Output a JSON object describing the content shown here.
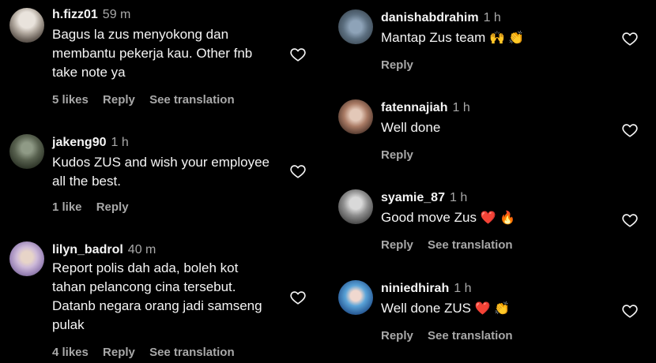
{
  "left_comments": [
    {
      "username": "h.fizz01",
      "time": "59 m",
      "lines": [
        "Bagus la zus menyokong dan",
        "membantu pekerja kau. Other fnb",
        "take note ya"
      ],
      "likes": "5 likes",
      "reply": "Reply",
      "translate": "See translation"
    },
    {
      "username": "jakeng90",
      "time": "1 h",
      "lines": [
        "Kudos ZUS and wish your employee",
        "all the best."
      ],
      "likes": "1 like",
      "reply": "Reply",
      "translate": ""
    },
    {
      "username": "lilyn_badrol",
      "time": "40 m",
      "lines": [
        "Report polis dah ada, boleh kot",
        "tahan pelancong cina tersebut.",
        "Datanb negara orang jadi samseng",
        "pulak"
      ],
      "likes": "4 likes",
      "reply": "Reply",
      "translate": "See translation"
    }
  ],
  "right_comments": [
    {
      "username": "danishabdrahim",
      "time": "1 h",
      "text": "Mantap Zus team",
      "emoji": "🙌 👏",
      "reply": "Reply",
      "translate": ""
    },
    {
      "username": "fatennajiah",
      "time": "1 h",
      "text": "Well done",
      "emoji": "",
      "reply": "Reply",
      "translate": ""
    },
    {
      "username": "syamie_87",
      "time": "1 h",
      "text": "Good move Zus",
      "emoji": "❤️ 🔥",
      "reply": "Reply",
      "translate": "See translation"
    },
    {
      "username": "niniedhirah",
      "time": "1 h",
      "text": "Well done ZUS",
      "emoji": "❤️ 👏",
      "reply": "Reply",
      "translate": "See translation"
    }
  ],
  "icons": {
    "like": "heart-outline-icon"
  },
  "colors": {
    "background": "#000000",
    "text": "#f5f5f5",
    "muted": "#a8a8a8"
  }
}
